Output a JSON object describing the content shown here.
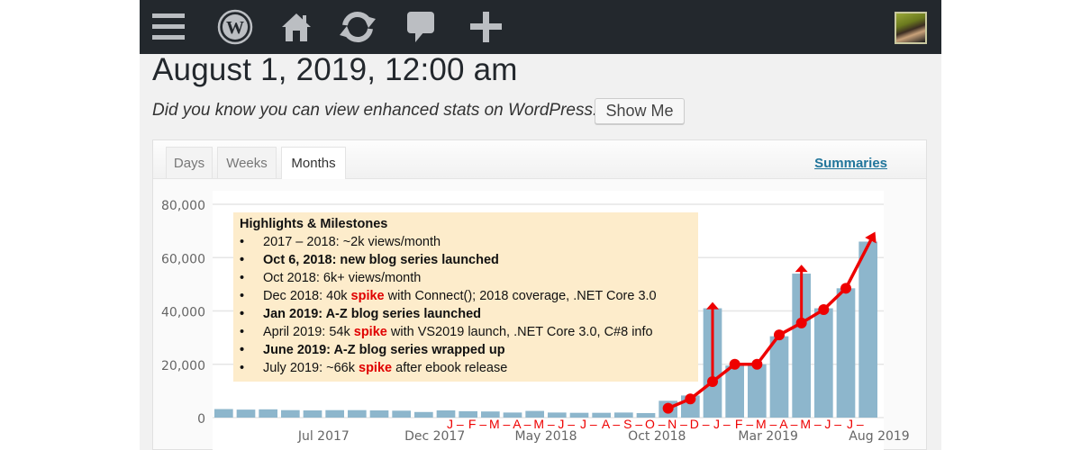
{
  "adminbar": {
    "icons": [
      "menu-icon",
      "wordpress-logo-icon",
      "home-icon",
      "updates-icon",
      "comments-icon",
      "new-content-icon"
    ],
    "avatar": "user-avatar"
  },
  "page": {
    "title": "August 1, 2019, 12:00 am",
    "notice": "Did you know you can view enhanced stats on WordPress.com?",
    "show_me_label": "Show Me"
  },
  "tabs": [
    {
      "label": "Days",
      "active": false
    },
    {
      "label": "Weeks",
      "active": false
    },
    {
      "label": "Months",
      "active": true
    }
  ],
  "summaries_label": "Summaries",
  "callout": {
    "title": "Highlights & Milestones",
    "items": [
      {
        "bold": false,
        "pre": "2017 – 2018: ~2k views/month",
        "spike": "",
        "post": ""
      },
      {
        "bold": true,
        "pre": "Oct 6, 2018: new blog series launched",
        "spike": "",
        "post": ""
      },
      {
        "bold": false,
        "pre": "Oct 2018: 6k+ views/month",
        "spike": "",
        "post": ""
      },
      {
        "bold": false,
        "pre": "Dec 2018:  40k ",
        "spike": "spike",
        "post": " with Connect(); 2018 coverage, .NET Core 3.0"
      },
      {
        "bold": true,
        "pre": "Jan 2019: A-Z blog series launched",
        "spike": "",
        "post": ""
      },
      {
        "bold": false,
        "pre": "April 2019: 54k ",
        "spike": "spike",
        "post": " with VS2019 launch, .NET Core 3.0, C#8 info"
      },
      {
        "bold": true,
        "pre": "June 2019: A-Z blog series wrapped up",
        "spike": "",
        "post": ""
      },
      {
        "bold": false,
        "pre": "July 2019: ~66k ",
        "spike": "spike",
        "post": " after ebook release"
      }
    ]
  },
  "colors": {
    "bar": "#8db6cc",
    "annotation": "#ee0000",
    "callout_bg": "#fdeccb",
    "link": "#21759b"
  },
  "chart_data": {
    "type": "bar",
    "title": "",
    "xlabel": "",
    "ylabel": "",
    "ylim": [
      0,
      80000
    ],
    "grid": true,
    "yticks": [
      0,
      20000,
      40000,
      60000,
      80000
    ],
    "ytick_labels": [
      "0",
      "20,000",
      "40,000",
      "60,000",
      "80,000"
    ],
    "xtick_labels": [
      {
        "label": "Jul 2017",
        "index": 5
      },
      {
        "label": "Dec 2017",
        "index": 10
      },
      {
        "label": "May 2018",
        "index": 15
      },
      {
        "label": "Oct 2018",
        "index": 20
      },
      {
        "label": "Mar 2019",
        "index": 25
      },
      {
        "label": "Aug 2019",
        "index": 30
      }
    ],
    "categories": [
      "Feb 2017",
      "Mar 2017",
      "Apr 2017",
      "May 2017",
      "Jun 2017",
      "Jul 2017",
      "Aug 2017",
      "Sep 2017",
      "Oct 2017",
      "Nov 2017",
      "Dec 2017",
      "Jan 2018",
      "Feb 2018",
      "Mar 2018",
      "Apr 2018",
      "May 2018",
      "Jun 2018",
      "Jul 2018",
      "Aug 2018",
      "Sep 2018",
      "Oct 2018",
      "Nov 2018",
      "Dec 2018",
      "Jan 2019",
      "Feb 2019",
      "Mar 2019",
      "Apr 2019",
      "May 2019",
      "Jun 2019",
      "Jul 2019"
    ],
    "values": [
      3200,
      3000,
      3100,
      2800,
      2700,
      2800,
      2800,
      2700,
      2600,
      2100,
      2700,
      2400,
      2300,
      1900,
      2500,
      1900,
      1800,
      1800,
      1900,
      1700,
      6300,
      8300,
      41000,
      19500,
      20000,
      30500,
      54000,
      41000,
      48500,
      66000
    ],
    "month_letters": {
      "start_index": 11,
      "labels": [
        "J",
        "F",
        "M",
        "A",
        "M",
        "J",
        "J",
        "A",
        "S",
        "O",
        "N",
        "D",
        "J",
        "F",
        "M",
        "A",
        "M",
        "J",
        "J"
      ]
    },
    "trend_annotation": {
      "start_index": 20,
      "points": [
        3500,
        7000,
        13500,
        20000,
        20000,
        31000,
        35500,
        40500,
        48500,
        66500
      ],
      "spike_arrows": [
        {
          "index": 22,
          "from": 13500,
          "to": 43000
        },
        {
          "index": 26,
          "from": 35500,
          "to": 57000
        }
      ]
    }
  }
}
